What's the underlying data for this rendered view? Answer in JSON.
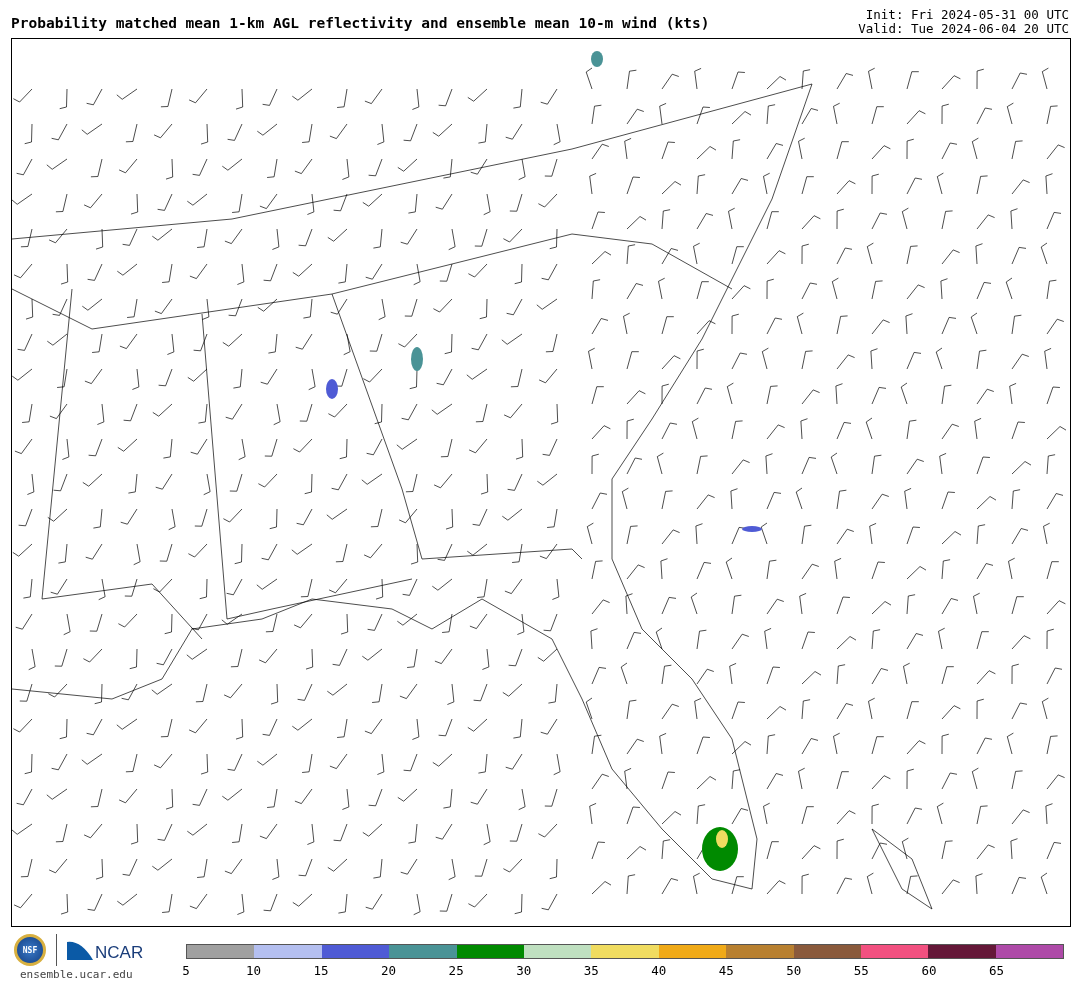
{
  "title": "Probability matched mean 1-km AGL reflectivity and ensemble mean 10-m wind (kts)",
  "init": "Init: Fri 2024-05-31 00 UTC",
  "valid": "Valid: Tue 2024-06-04 20 UTC",
  "footer": {
    "seal_text": "NSF",
    "logo_text": "NCAR",
    "url": "ensemble.ucar.edu"
  },
  "colorbar": {
    "bins": [
      {
        "label": "5",
        "color": "#a0a0a0"
      },
      {
        "label": "10",
        "color": "#b4bff0"
      },
      {
        "label": "15",
        "color": "#4f5bd5"
      },
      {
        "label": "20",
        "color": "#4a9396"
      },
      {
        "label": "25",
        "color": "#008a00"
      },
      {
        "label": "30",
        "color": "#bfe0c0"
      },
      {
        "label": "35",
        "color": "#f0dc60"
      },
      {
        "label": "40",
        "color": "#f0aa18"
      },
      {
        "label": "45",
        "color": "#b88030"
      },
      {
        "label": "50",
        "color": "#8a5a3c"
      },
      {
        "label": "55",
        "color": "#f25080"
      },
      {
        "label": "60",
        "color": "#641838"
      },
      {
        "label": "65",
        "color": "#ae4aa8"
      }
    ]
  }
}
